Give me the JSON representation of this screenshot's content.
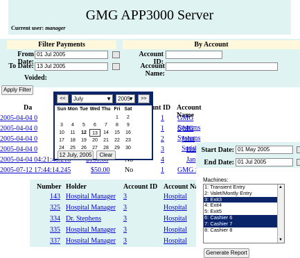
{
  "header": {
    "title": "GMG APP3000 Server",
    "current_user_label": "Current user:",
    "current_user": "manager"
  },
  "filter": {
    "section_payments": "Filter Payments",
    "section_account": "By Account",
    "from_date_label": "From Date:",
    "from_date_value": "01 Jul 2005",
    "to_date_label": "To Date:",
    "to_date_value": "13 Jul 2005",
    "voided_label": "Voided:",
    "account_id_label": "Account ID:",
    "account_id_value": "",
    "account_name_label": "Account Name:",
    "account_name_value": "",
    "apply_button": "Apply Filter"
  },
  "calendar": {
    "prev_label": "<<",
    "next_label": ">>",
    "month": "July",
    "year": "2005",
    "weekdays": [
      "Sun",
      "Mon",
      "Tue",
      "Wed",
      "Thu",
      "Fri",
      "Sat"
    ],
    "weeks": [
      [
        "",
        "",
        "",
        "",
        "",
        "1",
        "2"
      ],
      [
        "3",
        "4",
        "5",
        "6",
        "7",
        "8",
        "9"
      ],
      [
        "10",
        "11",
        "12",
        "13",
        "14",
        "15",
        "16"
      ],
      [
        "17",
        "18",
        "19",
        "20",
        "21",
        "22",
        "23"
      ],
      [
        "24",
        "25",
        "26",
        "27",
        "28",
        "29",
        "30"
      ],
      [
        "31",
        "",
        "",
        "",
        "",
        "",
        ""
      ]
    ],
    "today_button": "12 July, 2005",
    "clear_button": "Clear"
  },
  "payments": {
    "col_date": "Da",
    "col_account_id": "unt ID",
    "col_account_name": "Account Name",
    "rows": [
      {
        "date": "2005-04-04 0",
        "amount": "",
        "voided": "",
        "account_id": "1",
        "account_name": "GMG Systems"
      },
      {
        "date": "2005-04-04 0",
        "amount": "",
        "voided": "",
        "account_id": "1",
        "account_name": "GMG Systems"
      },
      {
        "date": "2005-04-04 0",
        "amount": "",
        "voided": "",
        "account_id": "2",
        "account_name": "John Smith"
      },
      {
        "date": "2005-04-04 0",
        "amount": "",
        "voided": "",
        "account_id": "3",
        "account_name": "Hos"
      },
      {
        "date": "2005-04-04 04:21:48.218",
        "amount": "$150.00",
        "voided": "No",
        "account_id": "4",
        "account_name": "Jan"
      },
      {
        "date": "2005-07-12 17:44:14.245",
        "amount": "$50.00",
        "voided": "No",
        "account_id": "1",
        "account_name": "GMG S"
      }
    ]
  },
  "holders": {
    "col_number": "Number",
    "col_holder": "Holder",
    "col_account_id": "Account ID",
    "col_account_name": "Account Name",
    "rows": [
      {
        "number": "143",
        "holder": "Hospital Manager",
        "account_id": "3",
        "account_name": "Hospital"
      },
      {
        "number": "325",
        "holder": "Hospital Manager",
        "account_id": "3",
        "account_name": "Hospital"
      },
      {
        "number": "334",
        "holder": "Dr. Stephens",
        "account_id": "3",
        "account_name": "Hospital"
      },
      {
        "number": "335",
        "holder": "Hospital Manager",
        "account_id": "3",
        "account_name": "Hospital"
      },
      {
        "number": "337",
        "holder": "Hospital Manager",
        "account_id": "3",
        "account_name": "Hospital"
      }
    ]
  },
  "report": {
    "start_date_label": "Start Date:",
    "start_date_value": "01 May 2005",
    "end_date_label": "End Date:",
    "end_date_value": "01 Jul 2005",
    "machines_label": "Machines:",
    "machines": [
      {
        "label": "1: Transient Entry",
        "selected": false
      },
      {
        "label": "2: Valet/Montly Entry",
        "selected": false
      },
      {
        "label": "3: Exit3",
        "selected": true
      },
      {
        "label": "4: Exit4",
        "selected": false
      },
      {
        "label": "5: Exit5",
        "selected": false
      },
      {
        "label": "6: Cashier 6",
        "selected": true
      },
      {
        "label": "7: Cashier 7",
        "selected": true
      },
      {
        "label": "8: Cashier 8",
        "selected": false
      }
    ],
    "generate_button": "Generate Report"
  },
  "colors": {
    "panel_bg": "#dff3f3",
    "section_header_bg": "#fff8dc",
    "link": "#0000cc",
    "selection": "#0a246a"
  }
}
